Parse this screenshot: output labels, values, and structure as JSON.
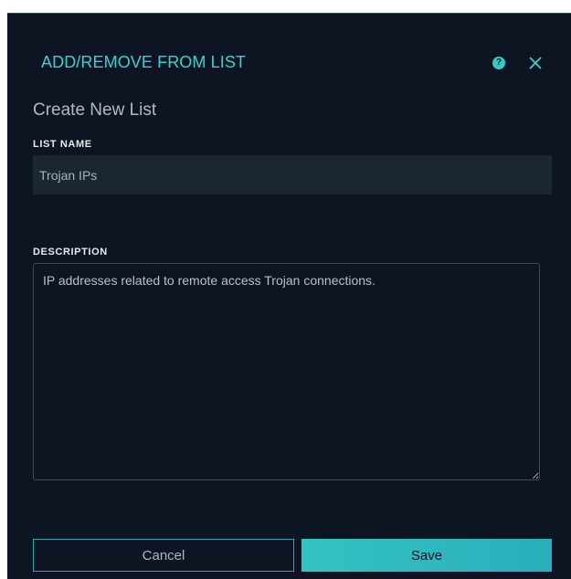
{
  "dialog": {
    "title": "ADD/REMOVE FROM LIST",
    "help_icon": "help-circle-icon",
    "help_glyph": "?",
    "close_icon": "close-icon"
  },
  "form": {
    "heading": "Create New List",
    "list_name_label": "LIST NAME",
    "list_name_value": "Trojan IPs",
    "description_label": "DESCRIPTION",
    "description_value": "IP addresses related to remote access Trojan connections."
  },
  "actions": {
    "cancel_label": "Cancel",
    "save_label": "Save"
  },
  "colors": {
    "background": "#0c1521",
    "accent": "#3ad1cf",
    "input_bg": "#1b2632",
    "save_button": "#2fb8bf"
  }
}
